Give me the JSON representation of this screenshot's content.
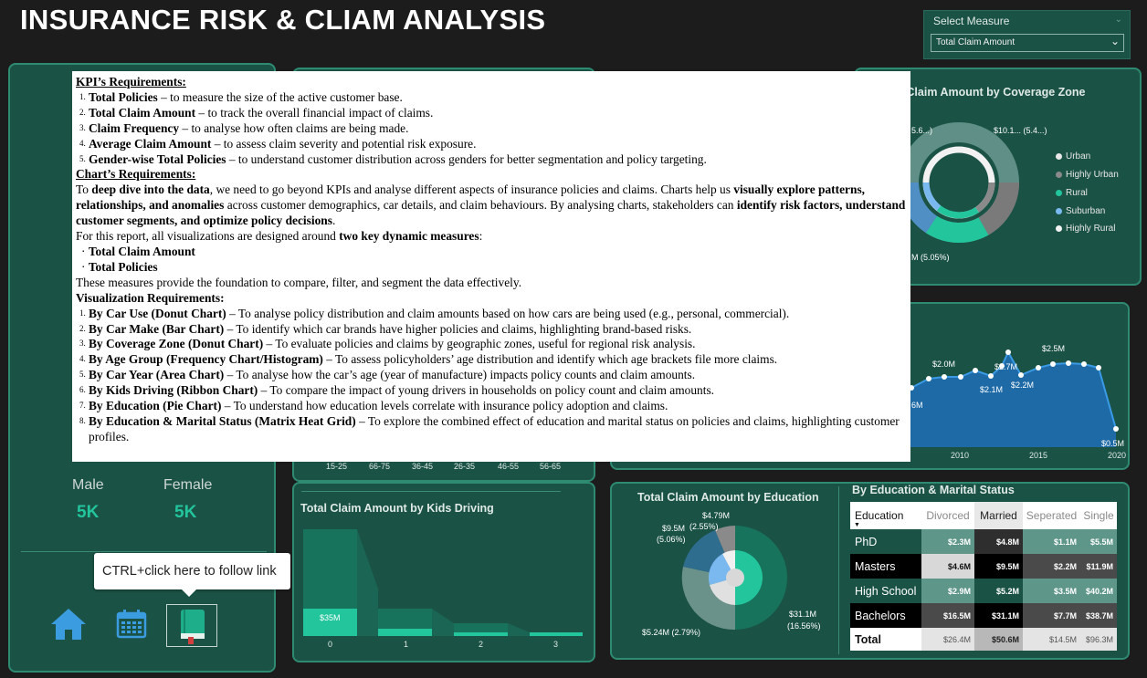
{
  "header": {
    "title": "INSURANCE RISK & CLIAM ANALYSIS"
  },
  "measure": {
    "label": "Select Measure",
    "value": "Total Claim Amount"
  },
  "doc": {
    "kpi_heading": "KPI’s Requirements:",
    "kpis": [
      {
        "n": "1.",
        "b": "Total Policies",
        "t": " – to measure the size of the active customer base."
      },
      {
        "n": "2.",
        "b": "Total Claim Amount",
        "t": " – to track the overall financial impact of claims."
      },
      {
        "n": "3.",
        "b": "Claim Frequency",
        "t": " – to analyse how often claims are being made."
      },
      {
        "n": "4.",
        "b": "Average Claim Amount",
        "t": " – to assess claim severity and potential risk exposure."
      },
      {
        "n": "5.",
        "b": "Gender-wise Total Policies",
        "t": " – to understand customer distribution across genders for better segmentation and policy targeting."
      }
    ],
    "chart_heading": "Chart’s Requirements:",
    "intro": [
      {
        "t": "To "
      },
      {
        "b": "deep dive into the data"
      },
      {
        "t": ", we need to go beyond KPIs and analyse different aspects of insurance policies and claims. Charts help us "
      },
      {
        "b": "visually explore patterns, relationships, and anomalies"
      },
      {
        "t": " across customer demographics, car details, and claim behaviours. By analysing charts, stakeholders can "
      },
      {
        "b": "identify risk factors, understand customer segments, and optimize policy decisions"
      },
      {
        "t": "."
      }
    ],
    "measures_pre": "For this report, all visualizations are designed around ",
    "measures_bold": "two key dynamic measures",
    "measures_post": ":",
    "bullets": [
      "Total Claim Amount",
      "Total Policies"
    ],
    "measures_note": "These measures provide the foundation to compare, filter, and segment the data effectively.",
    "viz_heading": "Visualization Requirements:",
    "viz": [
      {
        "n": "1.",
        "b": "By Car Use (Donut Chart)",
        "t": " – To analyse policy distribution and claim amounts based on how cars are being used (e.g., personal, commercial)."
      },
      {
        "n": "2.",
        "b": "By Car Make (Bar Chart)",
        "t": " – To identify which car brands have higher policies and claims, highlighting brand-based risks."
      },
      {
        "n": "3.",
        "b": "By Coverage Zone (Donut Chart)",
        "t": " – To evaluate policies and claims by geographic zones, useful for regional risk analysis."
      },
      {
        "n": "4.",
        "b": "By Age Group (Frequency Chart/Histogram)",
        "t": " – To assess policyholders’ age distribution and identify which age brackets file more claims."
      },
      {
        "n": "5.",
        "b": "By Car Year (Area Chart)",
        "t": " – To analyse how the car’s age (year of manufacture) impacts policy counts and claim amounts."
      },
      {
        "n": "6.",
        "b": "By Kids Driving (Ribbon Chart)",
        "t": " – To compare the impact of young drivers in households on policy count and claim amounts."
      },
      {
        "n": "7.",
        "b": "By Education (Pie Chart)",
        "t": " – To understand how education levels correlate with insurance policy adoption and claims."
      },
      {
        "n": "8.",
        "b": "By Education & Marital Status (Matrix Heat Grid)",
        "t": " – To explore the combined effect of education and marital status on policies and claims, highlighting customer profiles."
      }
    ]
  },
  "gender": {
    "male_label": "Male",
    "female_label": "Female",
    "male_value": "5K",
    "female_value": "5K"
  },
  "tooltip": {
    "text": "CTRL+click here to follow link"
  },
  "nav": {
    "home": "home-icon",
    "calendar": "calendar-icon",
    "book": "book-icon"
  },
  "age_axis": [
    "15-25",
    "66-75",
    "36-45",
    "26-35",
    "46-55",
    "56-65"
  ],
  "coverage": {
    "title": "Total Claim Amount by Coverage Zone",
    "labels": [
      "5.6...)",
      "$10.1... (5.4...)",
      "M (5.05%)"
    ],
    "legend": [
      {
        "name": "Urban",
        "color": "#e8e8e8"
      },
      {
        "name": "Highly Urban",
        "color": "#8a8a8a"
      },
      {
        "name": "Rural",
        "color": "#22c59c"
      },
      {
        "name": "Suburban",
        "color": "#7ab8f0"
      },
      {
        "name": "Highly Rural",
        "color": "#f2f2f2"
      }
    ]
  },
  "car_year": {
    "labels": [
      "$2.0M",
      "$2.7M",
      "$2.1M",
      "$2.2M",
      "$2.5M",
      "$0.5M",
      "6M"
    ],
    "x_ticks": [
      "2010",
      "2015",
      "2020"
    ]
  },
  "kids": {
    "title": "Total Claim Amount by Kids Driving",
    "bar_label": "$35M",
    "x_ticks": [
      "0",
      "1",
      "2",
      "3"
    ]
  },
  "education": {
    "title": "Total Claim Amount by Education",
    "labels": {
      "top": "$4.79M",
      "top_pct": "(2.55%)",
      "left": "$9.5M",
      "left_pct": "(5.06%)",
      "right": "$31.1M",
      "right_pct": "(16.56%)",
      "bottom": "$5.24M (2.79%)"
    }
  },
  "matrix": {
    "title": "By Education & Marital Status",
    "columns": [
      "Education",
      "Divorced",
      "Married",
      "Seperated",
      "Single"
    ],
    "rows": [
      {
        "label": "PhD",
        "values": [
          "$2.3M",
          "$4.8M",
          "$1.1M",
          "$5.5M"
        ]
      },
      {
        "label": "Masters",
        "values": [
          "$4.6M",
          "$9.5M",
          "$2.2M",
          "$11.9M"
        ]
      },
      {
        "label": "High School",
        "values": [
          "$2.9M",
          "$5.2M",
          "$3.5M",
          "$40.2M"
        ]
      },
      {
        "label": "Bachelors",
        "values": [
          "$16.5M",
          "$31.1M",
          "$7.7M",
          "$38.7M"
        ]
      }
    ],
    "total": {
      "label": "Total",
      "values": [
        "$26.4M",
        "$50.6M",
        "$14.5M",
        "$96.3M"
      ]
    }
  },
  "colors": {
    "panel": "#1a5245",
    "border": "#2f8a72",
    "accent": "#22c59c",
    "area": "#1d6aa6"
  }
}
